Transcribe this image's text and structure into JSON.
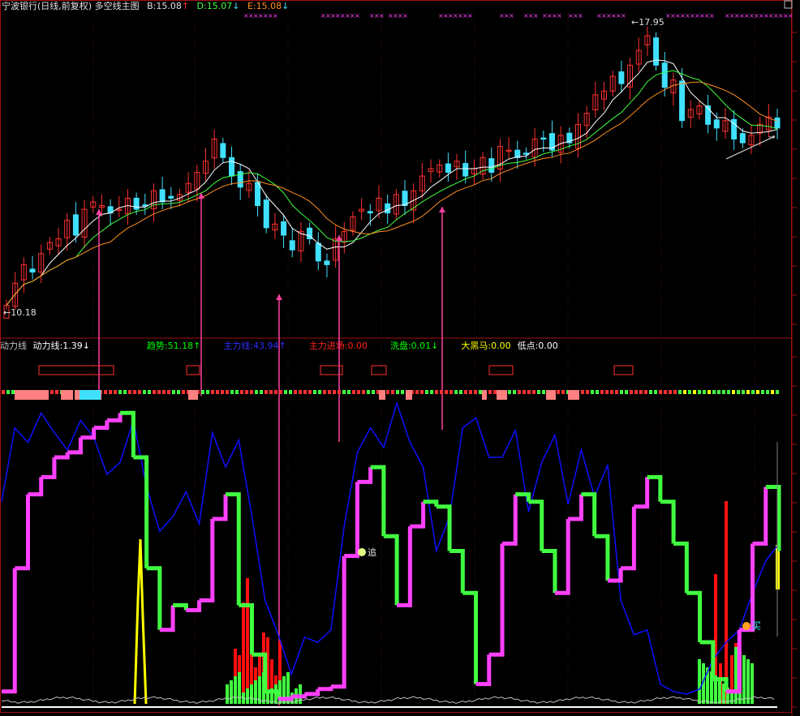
{
  "header": {
    "title": "宁波银行(日线,前复权) 多空线主图",
    "b_label": "B:15.08",
    "d_label": "D:15.07",
    "e_label": "E:15.08",
    "arrow_up": "↑",
    "arrow_down": "↓"
  },
  "price_panel": {
    "high_label": "17.95",
    "low_label": "10.18"
  },
  "indicator_header": {
    "name": "动力线",
    "items": [
      {
        "label": "动力线:1.39",
        "arrow": "↓",
        "color": "#ffffff"
      },
      {
        "label": "趋势:51.18",
        "arrow": "↑",
        "color": "#00ff00"
      },
      {
        "label": "主力线:43.94",
        "arrow": "↑",
        "color": "#3030ff"
      },
      {
        "label": "主力进场:0.00",
        "arrow": "",
        "color": "#ff2020"
      },
      {
        "label": "洗盘:0.01",
        "arrow": "↓",
        "color": "#00ff00"
      },
      {
        "label": "大黑马:0.00",
        "arrow": "",
        "color": "#ffff00"
      },
      {
        "label": "低点:0.00",
        "arrow": "",
        "color": "#ffffff"
      }
    ]
  },
  "markers": {
    "buy_label": "买",
    "chase_label": "追"
  },
  "chart_data": {
    "type": "line",
    "price_range": [
      10.18,
      17.95
    ],
    "colors": {
      "up": "#ff3030",
      "down": "#40e0ff",
      "ma_white": "#ffffff",
      "ma_green": "#40ff40",
      "ma_orange": "#ff9020",
      "signal_arrow": "#ff40a0",
      "power_up": "#ff40ff",
      "power_down": "#40ff40",
      "main_line": "#1010ff"
    },
    "price_close": [
      10.3,
      10.9,
      11.4,
      11.2,
      11.7,
      12.0,
      12.1,
      12.6,
      12.2,
      12.9,
      13.1,
      13.0,
      12.8,
      12.9,
      13.2,
      12.9,
      13.0,
      13.4,
      13.1,
      13.2,
      13.3,
      13.6,
      13.9,
      14.2,
      14.8,
      14.3,
      13.8,
      13.5,
      13.6,
      13.0,
      12.4,
      12.5,
      12.2,
      11.8,
      12.3,
      12.1,
      11.5,
      11.4,
      12.1,
      12.3,
      12.7,
      12.9,
      12.8,
      13.2,
      12.8,
      13.3,
      13.0,
      13.4,
      13.8,
      14.0,
      14.1,
      13.9,
      14.2,
      13.8,
      14.0,
      14.3,
      13.9,
      14.6,
      14.5,
      14.3,
      14.4,
      14.8,
      14.8,
      14.5,
      14.9,
      14.7,
      15.2,
      15.5,
      16.0,
      16.1,
      16.5,
      16.3,
      16.8,
      17.2,
      17.6,
      16.8,
      16.2,
      16.4,
      15.3,
      15.6,
      15.7,
      15.2,
      15.1,
      15.3,
      14.8,
      14.7,
      14.9,
      15.2,
      15.4,
      15.1
    ],
    "power_line": [
      5,
      55,
      85,
      92,
      100,
      102,
      108,
      112,
      115,
      118,
      100,
      55,
      30,
      40,
      38,
      42,
      75,
      85,
      40,
      20,
      5,
      2,
      3,
      4,
      6,
      7,
      60,
      90,
      96,
      68,
      40,
      72,
      82,
      80,
      62,
      45,
      8,
      20,
      65,
      85,
      82,
      62,
      45,
      75,
      85,
      68,
      50,
      55,
      80,
      92,
      82,
      65,
      45,
      25,
      10,
      5,
      30,
      65,
      88,
      62
    ],
    "main_line": [
      82,
      112,
      106,
      118,
      110,
      103,
      115,
      108,
      93,
      98,
      115,
      88,
      70,
      76,
      86,
      73,
      110,
      96,
      107,
      76,
      42,
      28,
      12,
      27,
      25,
      30,
      72,
      102,
      112,
      104,
      122,
      106,
      96,
      62,
      76,
      112,
      116,
      100,
      100,
      111,
      78,
      98,
      109,
      81,
      103,
      84,
      97,
      42,
      28,
      30,
      8,
      5,
      4,
      6,
      18,
      25,
      30,
      45,
      58,
      65
    ]
  }
}
